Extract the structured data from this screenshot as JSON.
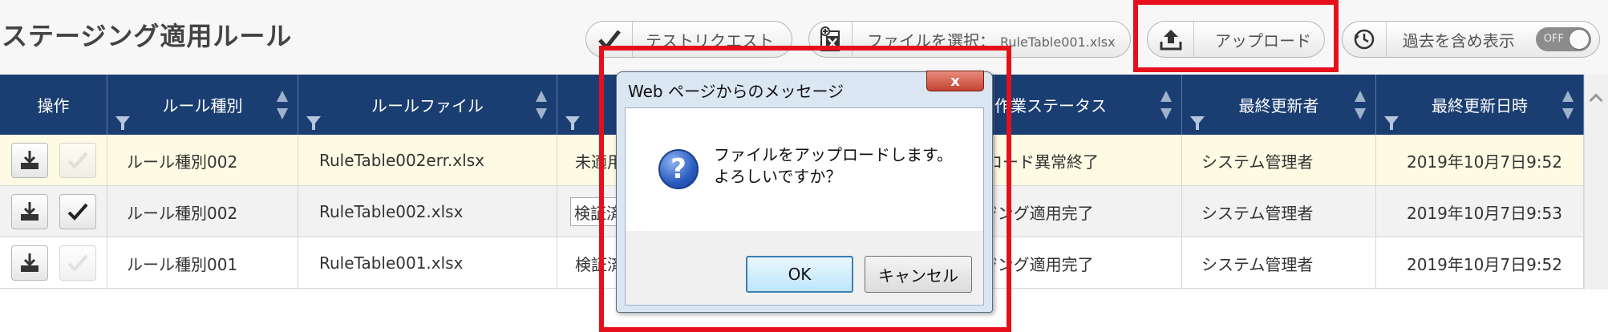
{
  "page": {
    "title": "ステージング適用ルール"
  },
  "toolbar": {
    "test_request_label": "テストリクエスト",
    "file_select_label": "ファイルを選択：",
    "file_select_value": "RuleTable001.xlsx",
    "upload_label": "アップロード",
    "show_past_label": "過去を含め表示",
    "toggle_label": "OFF"
  },
  "table": {
    "columns": [
      "操作",
      "ルール種別",
      "ルールファイル",
      "",
      "作業ステータス",
      "最終更新者",
      "最終更新日時"
    ],
    "rows": [
      {
        "rule_type": "ルール種別002",
        "rule_file": "RuleTable002err.xlsx",
        "status": "未適用",
        "work_status": "アップロード異常終了",
        "updated_by": "システム管理者",
        "updated_at": "2019年10月7日9:52"
      },
      {
        "rule_type": "ルール種別002",
        "rule_file": "RuleTable002.xlsx",
        "status": "検証済",
        "work_status": "ステージング適用完了",
        "updated_by": "システム管理者",
        "updated_at": "2019年10月7日9:53"
      },
      {
        "rule_type": "ルール種別001",
        "rule_file": "RuleTable001.xlsx",
        "status": "検証済",
        "work_status": "ステージング適用完了",
        "updated_by": "システム管理者",
        "updated_at": "2019年10月7日9:52"
      }
    ]
  },
  "dialog": {
    "title": "Web ページからのメッセージ",
    "close_label": "x",
    "message_line1": "ファイルをアップロードします。",
    "message_line2": "よろしいですか？",
    "ok_label": "OK",
    "cancel_label": "キャンセル",
    "icon": "question-icon"
  },
  "colors": {
    "header_bg": "#1b3e72",
    "highlight_row": "#fdfbe3",
    "alt_row": "#f2f2f2",
    "annotation_red": "#e5101c"
  }
}
